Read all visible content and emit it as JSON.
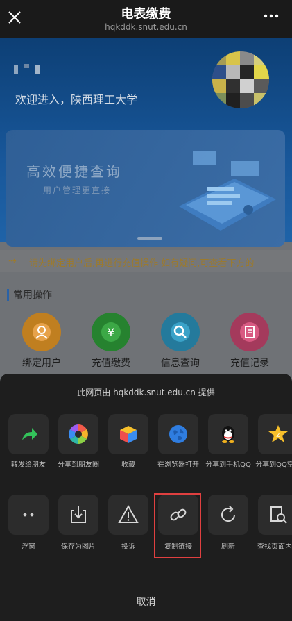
{
  "topbar": {
    "title": "电表缴费",
    "url": "hqkddk.snut.edu.cn"
  },
  "hero": {
    "welcome": "欢迎进入，陕西理工大学"
  },
  "banner": {
    "headline": "高效便捷查询",
    "subline": "用户管理更直接"
  },
  "notice": {
    "text": "请先绑定用户后,再进行充值操作 如有疑问,可查看下方的"
  },
  "section": {
    "title": "常用操作"
  },
  "operations": [
    {
      "label": "绑定用户",
      "color": "#d88f24"
    },
    {
      "label": "充值缴费",
      "color": "#2e9a3a"
    },
    {
      "label": "信息查询",
      "color": "#2a8fb8"
    },
    {
      "label": "充值记录",
      "color": "#c2466e"
    }
  ],
  "sheet": {
    "provided_by": "此网页由 hqkddk.snut.edu.cn 提供",
    "row1": [
      {
        "label": "转发给朋友",
        "icon": "forward-icon"
      },
      {
        "label": "分享到朋友圈",
        "icon": "moments-icon"
      },
      {
        "label": "收藏",
        "icon": "favorite-icon"
      },
      {
        "label": "在浏览器打开",
        "icon": "browser-icon"
      },
      {
        "label": "分享到手机QQ",
        "icon": "qq-icon"
      },
      {
        "label": "分享到QQ空间",
        "icon": "qzone-icon"
      }
    ],
    "row2": [
      {
        "label": "浮窗",
        "icon": "float-window-icon"
      },
      {
        "label": "保存为图片",
        "icon": "save-image-icon"
      },
      {
        "label": "投诉",
        "icon": "complaint-icon"
      },
      {
        "label": "复制链接",
        "icon": "copy-link-icon"
      },
      {
        "label": "刷新",
        "icon": "refresh-icon"
      },
      {
        "label": "查找页面内容",
        "icon": "search-page-icon"
      }
    ],
    "cancel": "取消"
  },
  "colors": {
    "sheet_bg": "#1e1e1e",
    "tile_bg": "#2c2c2c",
    "highlight": "#e04040",
    "accent_blue": "#2a62a6"
  }
}
